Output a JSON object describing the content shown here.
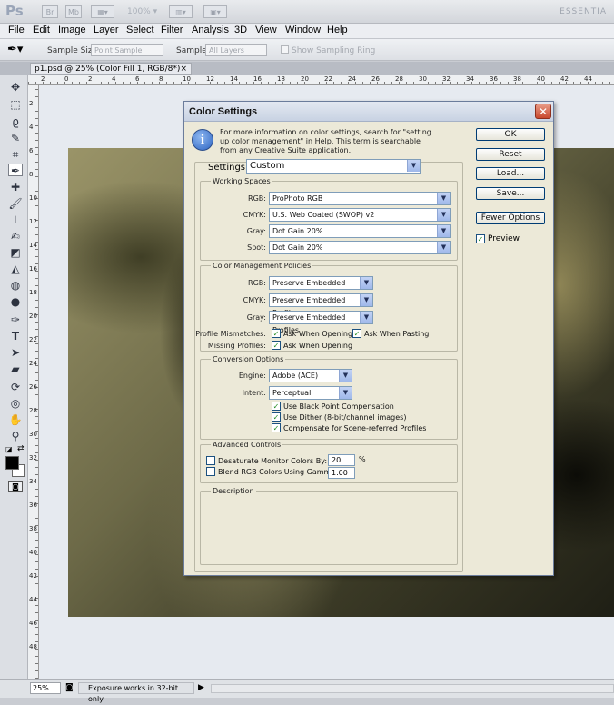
{
  "app": {
    "logo": "Ps",
    "top_icons": [
      "Br",
      "Mb"
    ],
    "zoom": "100%",
    "workspace": "ESSENTIA"
  },
  "menu": [
    "File",
    "Edit",
    "Image",
    "Layer",
    "Select",
    "Filter",
    "Analysis",
    "3D",
    "View",
    "Window",
    "Help"
  ],
  "options_bar": {
    "sample_size_label": "Sample Size:",
    "sample_size_value": "Point Sample",
    "sample_label": "Sample:",
    "sample_value": "All Layers",
    "sampling_ring_label": "Show Sampling Ring"
  },
  "document_tab": {
    "title": "p1.psd @ 25% (Color Fill 1, RGB/8*)",
    "close": "×"
  },
  "ruler": {
    "h_labels": [
      "2",
      "0",
      "2",
      "4",
      "6",
      "8",
      "10",
      "12",
      "14",
      "16",
      "18",
      "20",
      "22",
      "24",
      "26",
      "28",
      "30",
      "32",
      "34",
      "36",
      "38",
      "40",
      "42",
      "44"
    ],
    "v_labels": [
      "2",
      "4",
      "6",
      "8",
      "10",
      "12",
      "14",
      "16",
      "18",
      "20",
      "22",
      "24",
      "26",
      "28",
      "30",
      "32",
      "34",
      "36",
      "38",
      "40",
      "42",
      "44",
      "46",
      "48"
    ]
  },
  "status_bar": {
    "zoom": "25%",
    "message": "Exposure works in 32-bit only"
  },
  "dialog": {
    "title": "Color Settings",
    "close": "✕",
    "info_text": "For more information on color settings, search for \"setting up color management\" in Help. This term is searchable from any Creative Suite application.",
    "settings_label": "Settings:",
    "settings_value": "Custom",
    "working_spaces": {
      "title": "Working Spaces",
      "rows": [
        {
          "label": "RGB:",
          "value": "ProPhoto RGB"
        },
        {
          "label": "CMYK:",
          "value": "U.S. Web Coated (SWOP) v2"
        },
        {
          "label": "Gray:",
          "value": "Dot Gain 20%"
        },
        {
          "label": "Spot:",
          "value": "Dot Gain 20%"
        }
      ]
    },
    "policies": {
      "title": "Color Management Policies",
      "rows": [
        {
          "label": "RGB:",
          "value": "Preserve Embedded Profiles"
        },
        {
          "label": "CMYK:",
          "value": "Preserve Embedded Profiles"
        },
        {
          "label": "Gray:",
          "value": "Preserve Embedded Profiles"
        }
      ],
      "mismatches_label": "Profile Mismatches:",
      "ask_opening": "Ask When Opening",
      "ask_pasting": "Ask When Pasting",
      "missing_label": "Missing Profiles:",
      "missing_ask_opening": "Ask When Opening"
    },
    "conversion": {
      "title": "Conversion Options",
      "engine_label": "Engine:",
      "engine_value": "Adobe (ACE)",
      "intent_label": "Intent:",
      "intent_value": "Perceptual",
      "black_point": "Use Black Point Compensation",
      "dither": "Use Dither (8-bit/channel images)",
      "scene_referred": "Compensate for Scene-referred Profiles"
    },
    "advanced": {
      "title": "Advanced Controls",
      "desaturate_label": "Desaturate Monitor Colors By:",
      "desaturate_value": "20",
      "desaturate_unit": "%",
      "blend_label": "Blend RGB Colors Using Gamma:",
      "blend_value": "1.00"
    },
    "description": {
      "title": "Description"
    },
    "buttons": {
      "ok": "OK",
      "reset": "Reset",
      "load": "Load...",
      "save": "Save...",
      "fewer": "Fewer Options",
      "preview": "Preview"
    },
    "check_mark": "✓"
  }
}
